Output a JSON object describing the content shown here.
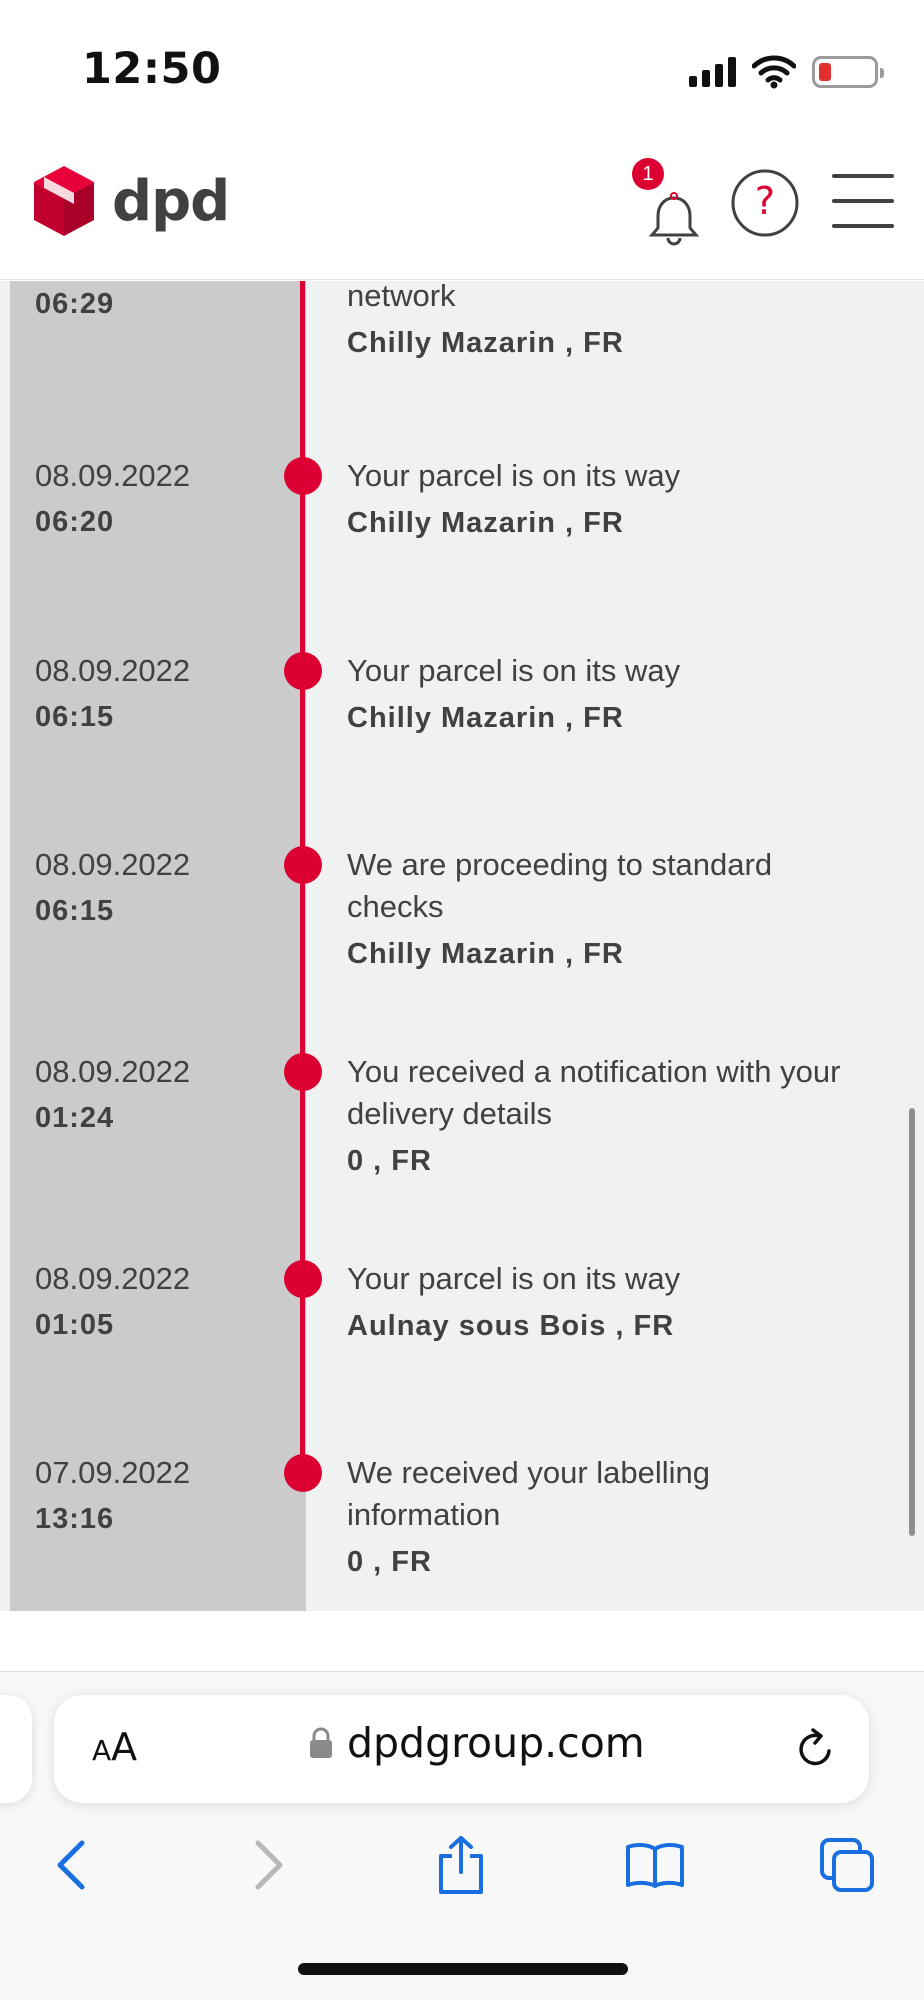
{
  "status_bar": {
    "time": "12:50"
  },
  "header": {
    "logo_text": "dpd",
    "notification_count": "1",
    "help_symbol": "?",
    "brand_color": "#dc0032"
  },
  "timeline": {
    "partial_top": {
      "time": "06:29",
      "status": "network",
      "location": "Chilly Mazarin , FR"
    },
    "events": [
      {
        "date": "08.09.2022",
        "time": "06:20",
        "status": "Your parcel is on its way",
        "location": "Chilly Mazarin , FR"
      },
      {
        "date": "08.09.2022",
        "time": "06:15",
        "status": "Your parcel is on its way",
        "location": "Chilly Mazarin , FR"
      },
      {
        "date": "08.09.2022",
        "time": "06:15",
        "status": "We are proceeding to standard checks",
        "location": "Chilly Mazarin , FR"
      },
      {
        "date": "08.09.2022",
        "time": "01:24",
        "status": "You received a notification with your delivery details",
        "location": "0 , FR"
      },
      {
        "date": "08.09.2022",
        "time": "01:05",
        "status": "Your parcel is on its way",
        "location": "Aulnay sous Bois , FR"
      },
      {
        "date": "07.09.2022",
        "time": "13:16",
        "status": "We received your labelling information",
        "location": "0 , FR"
      }
    ]
  },
  "browser": {
    "aa_label_big": "A",
    "aa_label_small": "A",
    "url": "dpdgroup.com",
    "toolbar_icons": [
      "back-icon",
      "forward-icon",
      "share-icon",
      "bookmarks-icon",
      "tabs-icon"
    ]
  }
}
